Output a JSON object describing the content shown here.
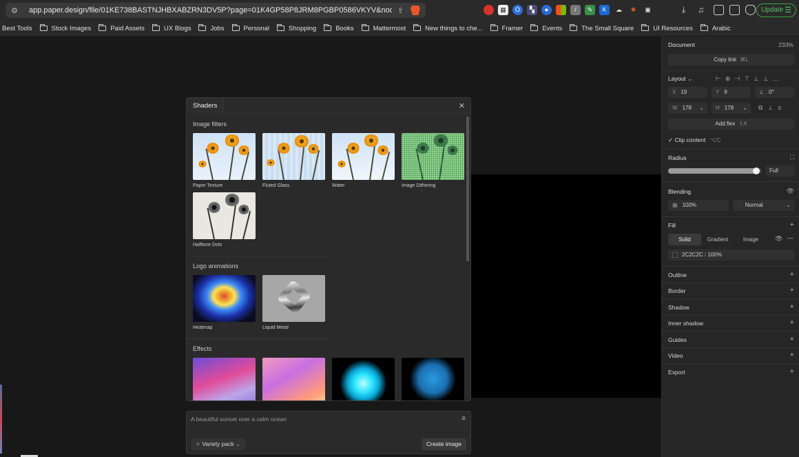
{
  "browser": {
    "url": "app.paper.design/file/01KE738BASTNJHBXABZRN3DV5P?page=01K4GP58P8JRM8PGBP0586VKYV&node=01...",
    "update_label": "Update",
    "bookmarks": [
      "Best Tools",
      "Stock Images",
      "Paid Assets",
      "UX Blogs",
      "Jobs",
      "Personal",
      "Shopping",
      "Books",
      "Mattermost",
      "New things to che...",
      "Framer",
      "Events",
      "The Small Square",
      "UI Resources",
      "Arabic"
    ]
  },
  "shaders": {
    "tab_label": "Shaders",
    "sections": [
      {
        "title": "Image filters",
        "items": [
          "Paper Texture",
          "Fluted Glass",
          "Water",
          "Image Dithering",
          "Halftone Dots"
        ]
      },
      {
        "title": "Logo animations",
        "items": [
          "Heatmap",
          "Liquid Metal"
        ]
      },
      {
        "title": "Effects",
        "items": [
          "",
          "",
          "",
          ""
        ]
      }
    ]
  },
  "prompt": {
    "placeholder": "A beautiful sunset over a calm ocean",
    "variety_label": "Variety pack",
    "create_label": "Create image"
  },
  "inspector": {
    "document_label": "Document",
    "zoom": "233%",
    "copy_link_label": "Copy link",
    "copy_link_shortcut": "⌘L",
    "layout_label": "Layout",
    "x": "19",
    "y": "9",
    "rotation": "0°",
    "w": "178",
    "h": "178",
    "add_flex_label": "Add flex",
    "add_flex_shortcut": "⇧A",
    "clip_content_label": "Clip content",
    "clip_content_shortcut": "⌥C",
    "radius_label": "Radius",
    "radius_value": "Full",
    "radius_fraction": 0.98,
    "blending_label": "Blending",
    "opacity": "100%",
    "blend_mode": "Normal",
    "fill_label": "Fill",
    "fill_tabs": [
      "Solid",
      "Gradient",
      "Image"
    ],
    "fill_color": "2C2C2C",
    "fill_opacity": "100%",
    "sections": [
      "Outline",
      "Border",
      "Shadow",
      "Inner shadow",
      "Guides",
      "Video",
      "Export"
    ]
  }
}
